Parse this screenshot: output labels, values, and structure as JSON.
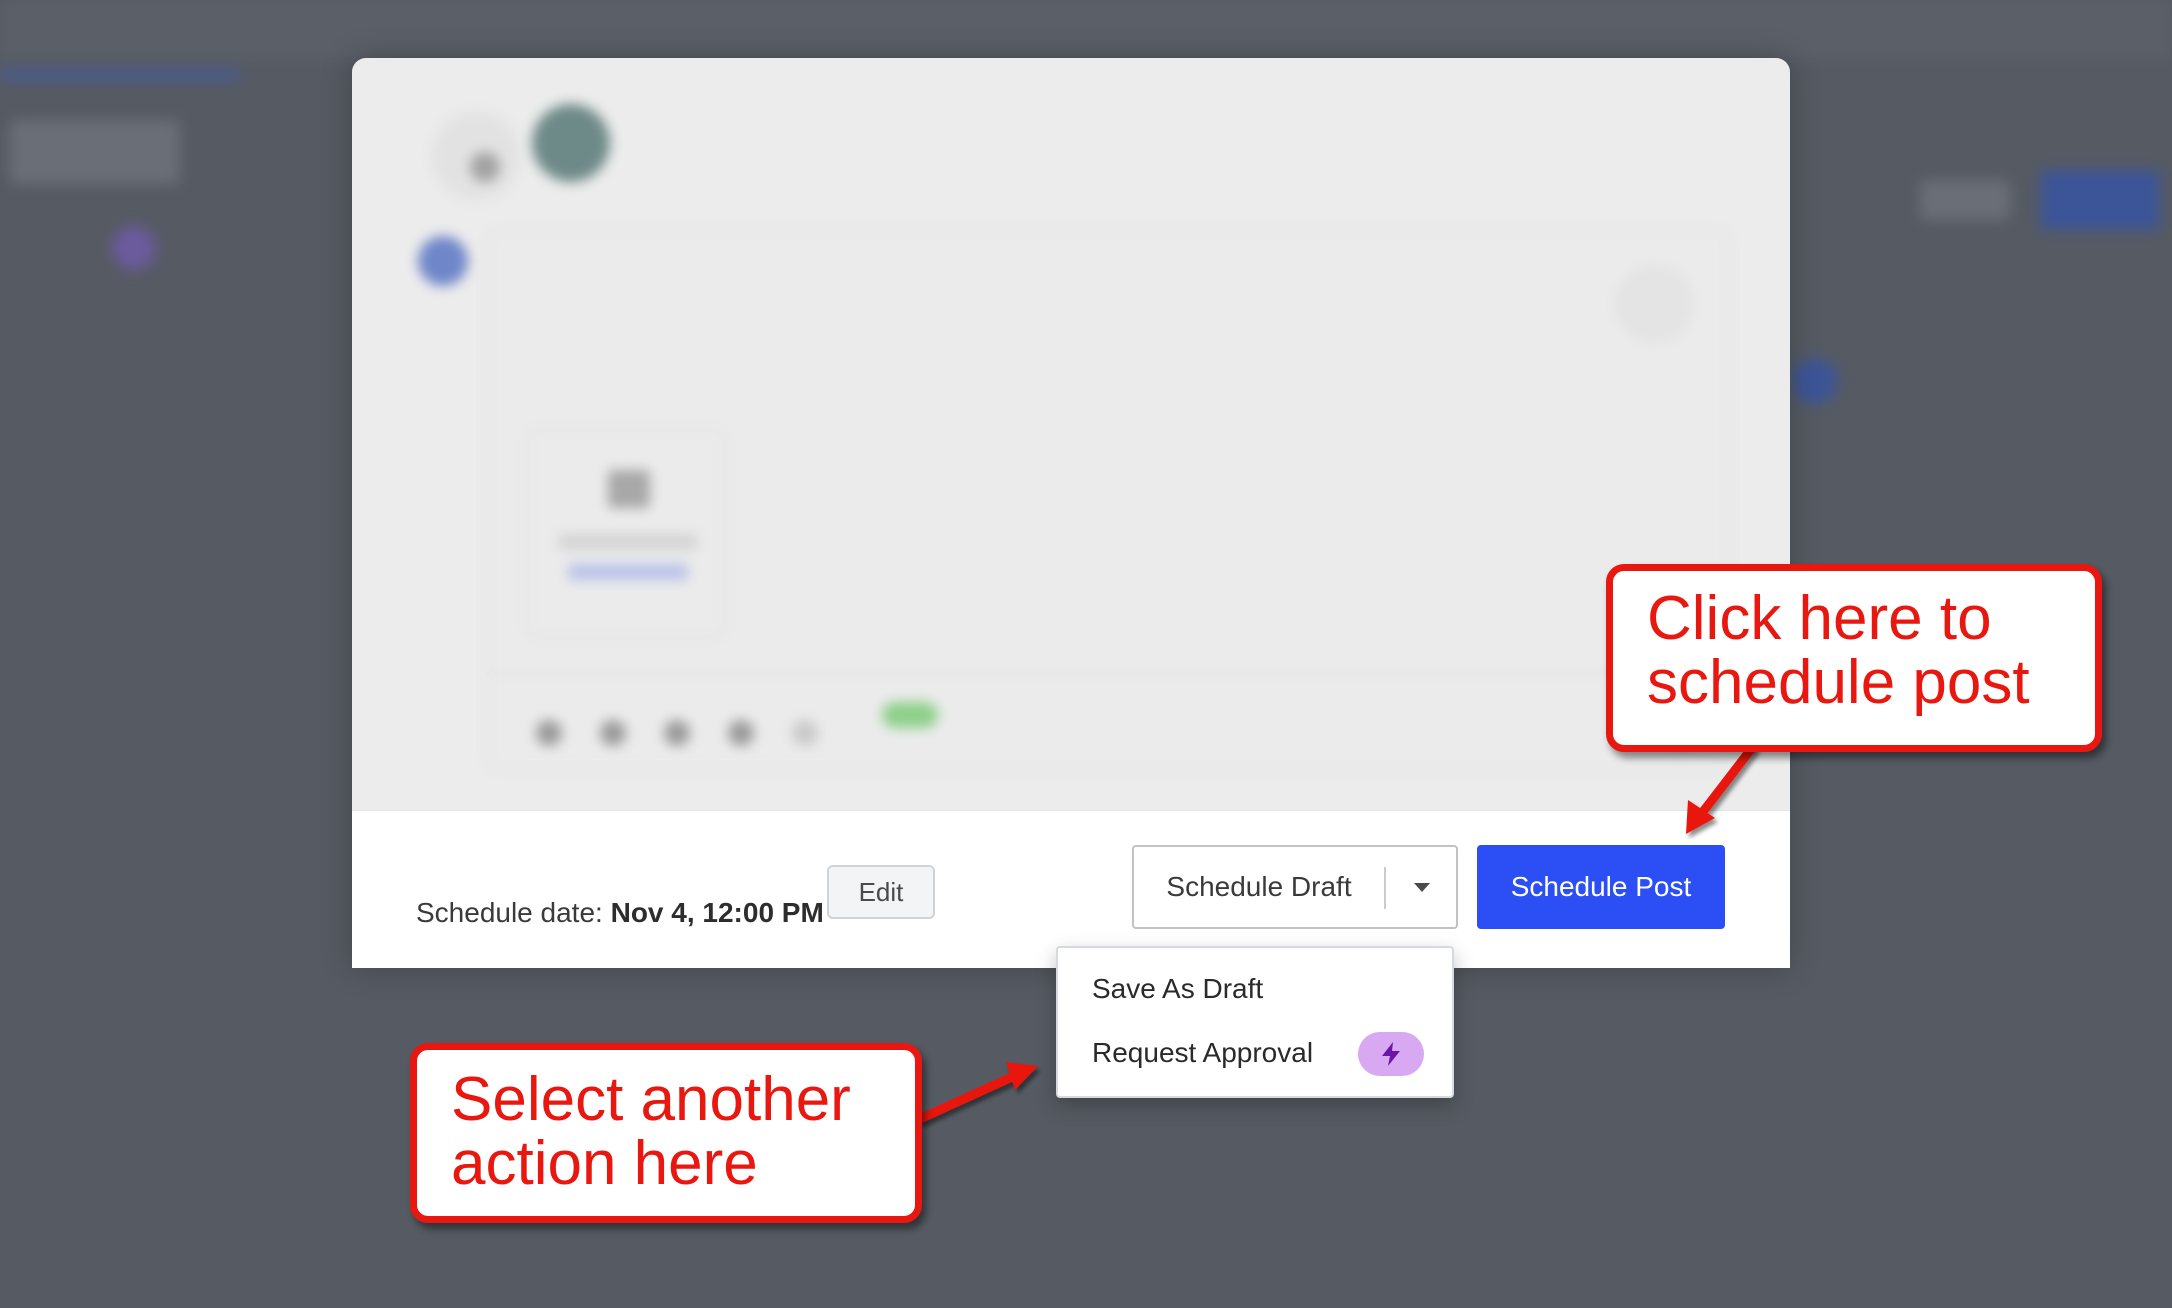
{
  "footer": {
    "schedule_label": "Schedule date:",
    "schedule_value": "Nov 4, 12:00 PM",
    "edit_label": "Edit",
    "draft_label": "Schedule Draft",
    "primary_label": "Schedule Post"
  },
  "menu": {
    "items": [
      {
        "label": "Save As Draft"
      },
      {
        "label": "Request Approval",
        "badge_icon": "bolt-icon"
      }
    ]
  },
  "callouts": {
    "top": {
      "line1": "Click here to",
      "line2": "schedule post"
    },
    "bottom": {
      "line1": "Select another",
      "line2": "action here"
    }
  },
  "colors": {
    "primary": "#2c4ef5",
    "callout": "#e8170f",
    "badge": "#d9a8f2",
    "badge_icon": "#6a17a8"
  }
}
